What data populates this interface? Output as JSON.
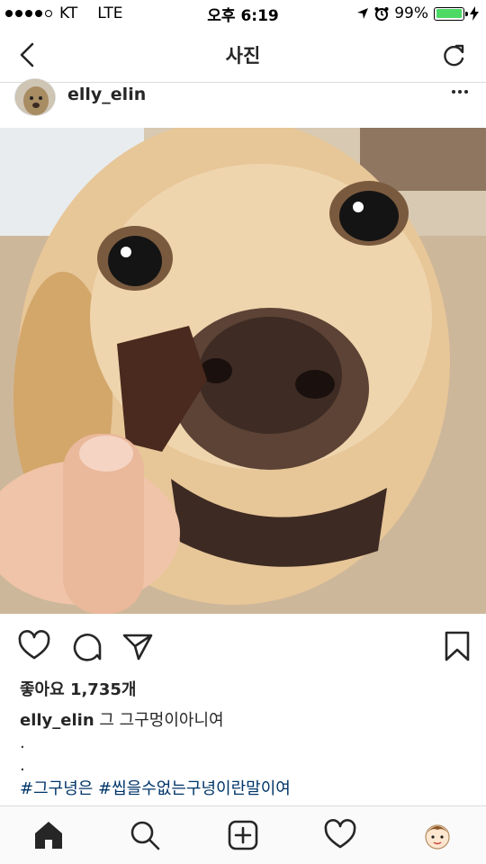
{
  "status_bar": {
    "carrier": "KT",
    "network": "LTE",
    "time": "오후 6:19",
    "battery_percent": "99%",
    "battery_level": 0.99
  },
  "nav": {
    "title": "사진",
    "back_icon": "chevron-left-icon",
    "refresh_icon": "refresh-icon"
  },
  "post": {
    "username": "elly_elin",
    "more_icon": "more-horizontal-icon",
    "likes_text": "좋아요 1,735개",
    "caption_user": "elly_elin",
    "caption_text": "그 그구멍이아니여",
    "dot_lines": [
      ".",
      "."
    ],
    "hashtags": "#그구녕은 #씹을수없는구녕이란말이여"
  },
  "actions": {
    "like_icon": "heart-outline-icon",
    "comment_icon": "comment-icon",
    "share_icon": "send-icon",
    "save_icon": "bookmark-icon"
  },
  "tabs": [
    "home-icon",
    "search-icon",
    "add-post-icon",
    "activity-heart-icon",
    "profile-avatar-icon"
  ]
}
